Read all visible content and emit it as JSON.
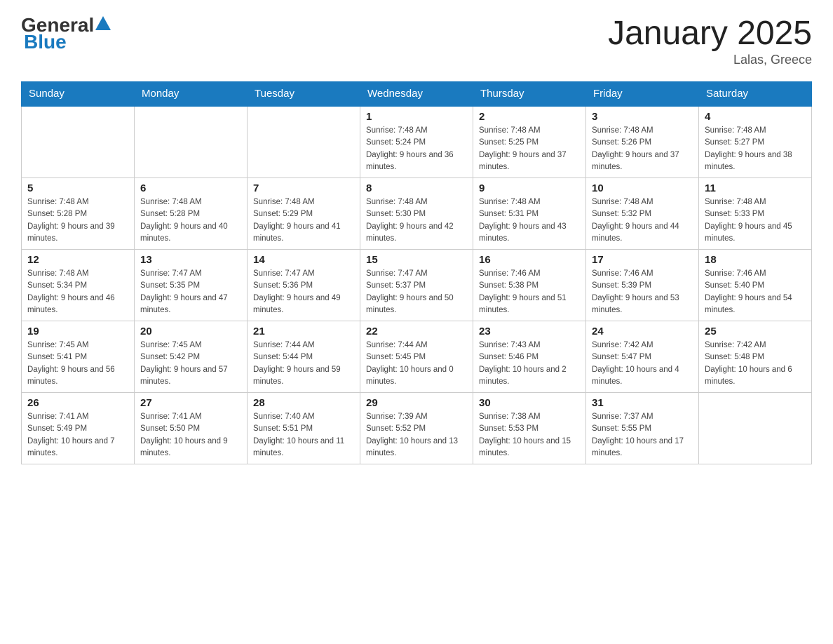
{
  "header": {
    "logo_general": "General",
    "logo_blue": "Blue",
    "title": "January 2025",
    "location": "Lalas, Greece"
  },
  "calendar": {
    "days_of_week": [
      "Sunday",
      "Monday",
      "Tuesday",
      "Wednesday",
      "Thursday",
      "Friday",
      "Saturday"
    ],
    "weeks": [
      [
        {
          "day": "",
          "info": ""
        },
        {
          "day": "",
          "info": ""
        },
        {
          "day": "",
          "info": ""
        },
        {
          "day": "1",
          "info": "Sunrise: 7:48 AM\nSunset: 5:24 PM\nDaylight: 9 hours and 36 minutes."
        },
        {
          "day": "2",
          "info": "Sunrise: 7:48 AM\nSunset: 5:25 PM\nDaylight: 9 hours and 37 minutes."
        },
        {
          "day": "3",
          "info": "Sunrise: 7:48 AM\nSunset: 5:26 PM\nDaylight: 9 hours and 37 minutes."
        },
        {
          "day": "4",
          "info": "Sunrise: 7:48 AM\nSunset: 5:27 PM\nDaylight: 9 hours and 38 minutes."
        }
      ],
      [
        {
          "day": "5",
          "info": "Sunrise: 7:48 AM\nSunset: 5:28 PM\nDaylight: 9 hours and 39 minutes."
        },
        {
          "day": "6",
          "info": "Sunrise: 7:48 AM\nSunset: 5:28 PM\nDaylight: 9 hours and 40 minutes."
        },
        {
          "day": "7",
          "info": "Sunrise: 7:48 AM\nSunset: 5:29 PM\nDaylight: 9 hours and 41 minutes."
        },
        {
          "day": "8",
          "info": "Sunrise: 7:48 AM\nSunset: 5:30 PM\nDaylight: 9 hours and 42 minutes."
        },
        {
          "day": "9",
          "info": "Sunrise: 7:48 AM\nSunset: 5:31 PM\nDaylight: 9 hours and 43 minutes."
        },
        {
          "day": "10",
          "info": "Sunrise: 7:48 AM\nSunset: 5:32 PM\nDaylight: 9 hours and 44 minutes."
        },
        {
          "day": "11",
          "info": "Sunrise: 7:48 AM\nSunset: 5:33 PM\nDaylight: 9 hours and 45 minutes."
        }
      ],
      [
        {
          "day": "12",
          "info": "Sunrise: 7:48 AM\nSunset: 5:34 PM\nDaylight: 9 hours and 46 minutes."
        },
        {
          "day": "13",
          "info": "Sunrise: 7:47 AM\nSunset: 5:35 PM\nDaylight: 9 hours and 47 minutes."
        },
        {
          "day": "14",
          "info": "Sunrise: 7:47 AM\nSunset: 5:36 PM\nDaylight: 9 hours and 49 minutes."
        },
        {
          "day": "15",
          "info": "Sunrise: 7:47 AM\nSunset: 5:37 PM\nDaylight: 9 hours and 50 minutes."
        },
        {
          "day": "16",
          "info": "Sunrise: 7:46 AM\nSunset: 5:38 PM\nDaylight: 9 hours and 51 minutes."
        },
        {
          "day": "17",
          "info": "Sunrise: 7:46 AM\nSunset: 5:39 PM\nDaylight: 9 hours and 53 minutes."
        },
        {
          "day": "18",
          "info": "Sunrise: 7:46 AM\nSunset: 5:40 PM\nDaylight: 9 hours and 54 minutes."
        }
      ],
      [
        {
          "day": "19",
          "info": "Sunrise: 7:45 AM\nSunset: 5:41 PM\nDaylight: 9 hours and 56 minutes."
        },
        {
          "day": "20",
          "info": "Sunrise: 7:45 AM\nSunset: 5:42 PM\nDaylight: 9 hours and 57 minutes."
        },
        {
          "day": "21",
          "info": "Sunrise: 7:44 AM\nSunset: 5:44 PM\nDaylight: 9 hours and 59 minutes."
        },
        {
          "day": "22",
          "info": "Sunrise: 7:44 AM\nSunset: 5:45 PM\nDaylight: 10 hours and 0 minutes."
        },
        {
          "day": "23",
          "info": "Sunrise: 7:43 AM\nSunset: 5:46 PM\nDaylight: 10 hours and 2 minutes."
        },
        {
          "day": "24",
          "info": "Sunrise: 7:42 AM\nSunset: 5:47 PM\nDaylight: 10 hours and 4 minutes."
        },
        {
          "day": "25",
          "info": "Sunrise: 7:42 AM\nSunset: 5:48 PM\nDaylight: 10 hours and 6 minutes."
        }
      ],
      [
        {
          "day": "26",
          "info": "Sunrise: 7:41 AM\nSunset: 5:49 PM\nDaylight: 10 hours and 7 minutes."
        },
        {
          "day": "27",
          "info": "Sunrise: 7:41 AM\nSunset: 5:50 PM\nDaylight: 10 hours and 9 minutes."
        },
        {
          "day": "28",
          "info": "Sunrise: 7:40 AM\nSunset: 5:51 PM\nDaylight: 10 hours and 11 minutes."
        },
        {
          "day": "29",
          "info": "Sunrise: 7:39 AM\nSunset: 5:52 PM\nDaylight: 10 hours and 13 minutes."
        },
        {
          "day": "30",
          "info": "Sunrise: 7:38 AM\nSunset: 5:53 PM\nDaylight: 10 hours and 15 minutes."
        },
        {
          "day": "31",
          "info": "Sunrise: 7:37 AM\nSunset: 5:55 PM\nDaylight: 10 hours and 17 minutes."
        },
        {
          "day": "",
          "info": ""
        }
      ]
    ]
  }
}
